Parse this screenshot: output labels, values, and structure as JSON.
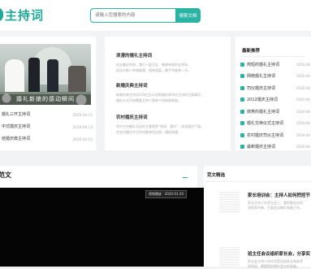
{
  "header": {
    "logo_text": "主持词",
    "search_placeholder": "请输入您搜索的内容",
    "search_button": "搜索文档"
  },
  "featured": {
    "photo_caption": "婚礼新娘的感动瞬间",
    "items": [
      {
        "title": "婚礼三开主持词",
        "date": "2020-04-11"
      },
      {
        "title": "中式婚庆主持词",
        "date": "2020-04-13"
      },
      {
        "title": "结婚庆典主持词",
        "date": "2020-04-15"
      }
    ]
  },
  "articles": [
    {
      "title": "浪漫的婚礼主持词",
      "excerpt": [
        "在这美好时刻，我们一起见证，感谢亲朋好友到场，",
        "愿这对新人幸福美满，相亲相爱，携手共度每一天。"
      ]
    },
    {
      "title": "新婚庆典主持词",
      "excerpt": [
        "新婚庆典主持词开场白怎么说新婚庆典司仪主持的注意事项，",
        "婚礼仪式开始需要主持人简单介绍新郎新娘。"
      ]
    },
    {
      "title": "农村婚庆主持词",
      "excerpt": [
        "农村主持婚礼活动的主题就是“热闹、喜庆”，体现喜庆气氛。",
        "在农村婚礼中主持词要亲切自然，通俗易懂。"
      ]
    }
  ],
  "recommend": {
    "title": "最新推荐",
    "items": [
      {
        "title": "简短的婚礼主持词",
        "date": "2020-04-11"
      },
      {
        "title": "网络婚礼主持词",
        "date": "2020-04-12"
      },
      {
        "title": "司仪婚庆主持词",
        "date": "2020-04-13"
      },
      {
        "title": "2012婚庆主持词",
        "date": "2020-04-14"
      },
      {
        "title": "搞笑的婚礼主持词",
        "date": "2020-04-15"
      },
      {
        "title": "婚礼交换仪式主持词",
        "date": "2020-04-16"
      },
      {
        "title": "农村婚庆司仪主持词",
        "date": "2020-04-17"
      },
      {
        "title": "最新婚庆主持词",
        "date": "2020-04-18"
      }
    ]
  },
  "section": {
    "title": "范文"
  },
  "video": {
    "badge": "视频播放 · 2020-01-20"
  },
  "side": {
    "title": "范文精选",
    "articles": [
      {
        "title": "家长培训会：主持人如何把控节",
        "excerpt": [
          "家长主持人在家长会上，要把握会议的",
          "流程和节奏，主要会议做好准备工作。"
        ]
      },
      {
        "title": "班主任会议组织家长会，分享实",
        "excerpt": [
          "家长会主持人的作用是连接家长和老师",
          "的桥梁，需要提前做好会议的准备。"
        ]
      }
    ]
  }
}
